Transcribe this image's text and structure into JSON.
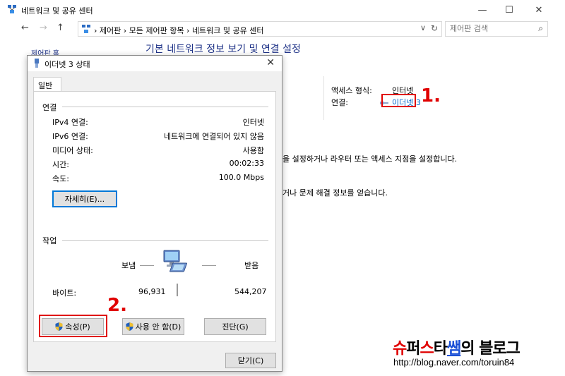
{
  "colors": {
    "accent": "#0066cc",
    "annotation": "#e00000",
    "heading": "#1e3287"
  },
  "main_window": {
    "title": "네트워크 및 공유 센터",
    "controls": {
      "minimize": "—",
      "maximize": "☐",
      "close": "✕"
    }
  },
  "address_bar": {
    "back": "←",
    "forward": "→",
    "up": "↑",
    "crumbs": [
      "제어판",
      "모든 제어판 항목",
      "네트워크 및 공유 센터"
    ],
    "separator": "›",
    "dropdown": "∨",
    "refresh": "↻",
    "search_placeholder": "제어판 검색",
    "search_icon": "⌕"
  },
  "main": {
    "heading": "기본 네트워크 정보 보기 및 연결 설정",
    "left_partial": "제어판 홈",
    "access_type_label": "액세스 형식:",
    "access_type_value": "인터넷",
    "connection_label": "연결:",
    "connection_link": "이더넷 3",
    "text1": "을 설정하거나 라우터 또는 액세스 지점을 설정합니다.",
    "text2": "거나 문제 해결 정보를 얻습니다."
  },
  "annotations": {
    "one": "1.",
    "two": "2."
  },
  "dialog": {
    "title": "이더넷 3 상태",
    "close": "✕",
    "tab": "일반",
    "connection_group": "연결",
    "rows": [
      {
        "label": "IPv4 연결:",
        "value": "인터넷"
      },
      {
        "label": "IPv6 연결:",
        "value": "네트워크에 연결되어 있지 않음"
      },
      {
        "label": "미디어 상태:",
        "value": "사용함"
      },
      {
        "label": "시간:",
        "value": "00:02:33"
      },
      {
        "label": "속도:",
        "value": "100.0 Mbps"
      }
    ],
    "details_button": "자세히(E)...",
    "activity_group": "작업",
    "sent_label": "보냄",
    "received_label": "받음",
    "bytes_label": "바이트:",
    "bytes_sent": "96,931",
    "bytes_received": "544,207",
    "properties_button": "속성(P)",
    "disable_button": "사용 안 함(D)",
    "diagnose_button": "진단(G)",
    "close_button": "닫기(C)"
  },
  "watermark": {
    "parts": [
      {
        "text": "슈",
        "color": "#e00000"
      },
      {
        "text": "퍼",
        "color": "#000000"
      },
      {
        "text": "스",
        "color": "#e00000"
      },
      {
        "text": "타",
        "color": "#000000"
      },
      {
        "text": "쌤",
        "color": "#1a4fd6"
      },
      {
        "text": "의 블로그",
        "color": "#000000"
      }
    ],
    "url": "http://blog.naver.com/toruin84"
  }
}
